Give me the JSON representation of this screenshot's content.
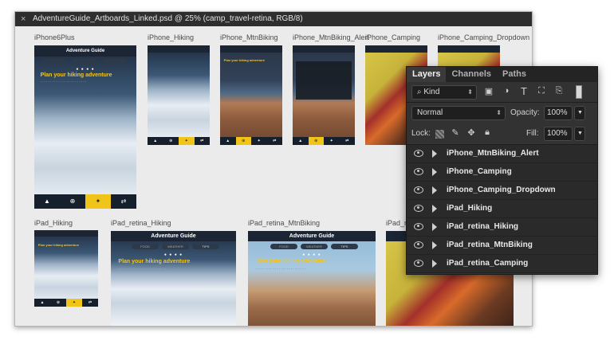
{
  "document": {
    "title": "AdventureGuide_Artboards_Linked.psd @ 25% (camp_travel-retina, RGB/8)",
    "close_glyph": "×"
  },
  "artboards": {
    "iphone6plus": {
      "label": "iPhone6Plus",
      "app_title": "Adventure Guide",
      "heading": "Plan your hiking adventure",
      "tabs": [
        "▲",
        "⊕",
        "✦",
        "⇄"
      ]
    },
    "iphone_hiking": {
      "label": "iPhone_Hiking"
    },
    "iphone_mtnbiking": {
      "label": "iPhone_MtnBiking",
      "heading": "Plan your biking adventure"
    },
    "iphone_mtnbiking_alert": {
      "label": "iPhone_MtnBiking_Alert"
    },
    "iphone_camping": {
      "label": "iPhone_Camping"
    },
    "iphone_camping_dropdown": {
      "label": "iPhone_Camping_Dropdown"
    },
    "ipad_hiking": {
      "label": "iPad_Hiking",
      "heading": "Plan your hiking adventure"
    },
    "ipad_retina_hiking": {
      "label": "iPad_retina_Hiking",
      "app_title": "Adventure Guide",
      "heading": "Plan your hiking adventure",
      "tabs": [
        "FOOD",
        "WEATHER",
        "TIPS"
      ]
    },
    "ipad_retina_mtnbiking": {
      "label": "iPad_retina_MtnBiking",
      "app_title": "Adventure Guide",
      "heading": "Plan your biking adventure",
      "tabs": [
        "FOOD",
        "WEATHER",
        "TIPS"
      ]
    },
    "ipad_retina_camping": {
      "label": "iPad_re"
    }
  },
  "layers_panel": {
    "tabs": [
      "Layers",
      "Channels",
      "Paths"
    ],
    "active_tab": "Layers",
    "filter_kind": "Kind",
    "blend_mode": "Normal",
    "opacity_label": "Opacity:",
    "opacity_value": "100%",
    "lock_label": "Lock:",
    "fill_label": "Fill:",
    "fill_value": "100%",
    "layers": [
      {
        "name": "iPhone_MtnBiking_Alert"
      },
      {
        "name": "iPhone_Camping"
      },
      {
        "name": "iPhone_Camping_Dropdown"
      },
      {
        "name": "iPad_Hiking"
      },
      {
        "name": "iPad_retina_Hiking"
      },
      {
        "name": "iPad_retina_MtnBiking"
      },
      {
        "name": "iPad_retina_Camping"
      }
    ]
  },
  "colors": {
    "accent": "#f0c419",
    "panel_bg": "#323232",
    "canvas_bg": "#ebebeb"
  }
}
